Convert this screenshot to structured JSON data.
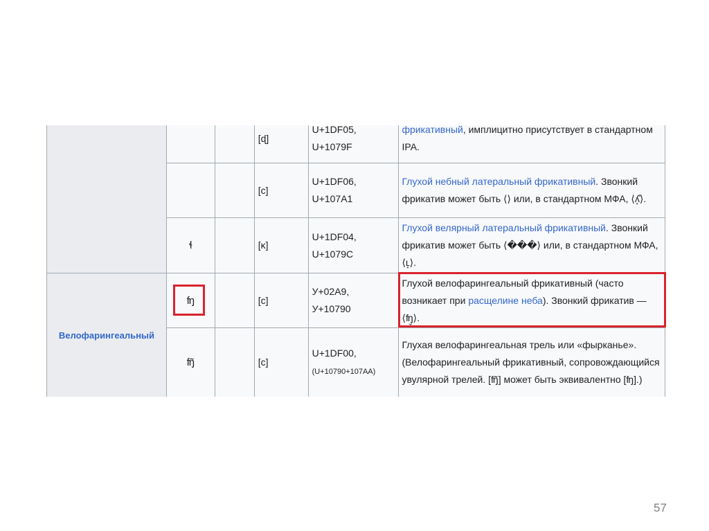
{
  "section_label": "Велофарингеальный",
  "rows": [
    {
      "glyph": "",
      "alt": "",
      "ipa": "[ɖ]",
      "code_line1": "U+1DF05,",
      "code_line2": "U+1079F",
      "desc_before": "",
      "desc_link": "фрикативный",
      "desc_after": ", имплицитно присутствует в стандартном IPA."
    },
    {
      "glyph": "",
      "alt": "",
      "ipa": "[c]",
      "code_line1": "U+1DF06,",
      "code_line2": "U+107A1",
      "desc_before": "",
      "desc_link": "Глухой небный латеральный фрикативный",
      "desc_after": ". Звонкий фрикатив может быть ⟨⟩ или, в стандартном МФА, ⟨ʎ̝̊⟩."
    },
    {
      "glyph": "ɬ",
      "alt": "",
      "ipa": "[ĸ]",
      "code_line1": "U+1DF04,",
      "code_line2": "U+1079C",
      "desc_before": "",
      "desc_link": "Глухой велярный латеральный фрикативный",
      "desc_after": ". Звонкий фрикатив может быть ⟨���⟩ или, в стандартном МФА, ⟨ʟ̝⟩."
    },
    {
      "glyph": "ʩ",
      "alt": "",
      "ipa": "[c]",
      "code_line1": "У+02А9,",
      "code_line2": "У+10790",
      "desc_before": "Глухой велофарингеальный фрикативный (часто возникает при ",
      "desc_link": "расщелине неба",
      "desc_after": "). Звонкий фрикатив — ⟨ʩ̬⟩."
    },
    {
      "glyph": "ʩ̃",
      "alt": "",
      "ipa": "[c]",
      "code_line1": "U+1DF00,",
      "code_line2": "(U+10790+107AA)",
      "desc_before": "Глухая велофарингеальная трель или «фырканье». (Велофарингеальный фрикативный, сопровождающийся увулярной трелей. [ʩ̃] может быть эквивалентно [ʩ].)",
      "desc_link": "",
      "desc_after": ""
    }
  ],
  "page_number": "57",
  "highlight_color": "#d9232d",
  "link_color": "#3366cc"
}
